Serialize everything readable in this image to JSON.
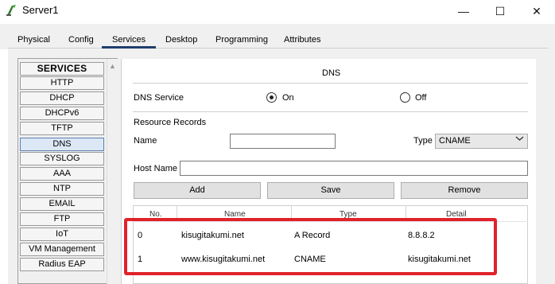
{
  "window": {
    "title": "Server1",
    "minimize_glyph": "—",
    "maximize_glyph": "☐",
    "close_glyph": "✕"
  },
  "tabs": [
    {
      "label": "Physical"
    },
    {
      "label": "Config"
    },
    {
      "label": "Services",
      "active": true
    },
    {
      "label": "Desktop"
    },
    {
      "label": "Programming"
    },
    {
      "label": "Attributes"
    }
  ],
  "services": {
    "header": "SERVICES",
    "items": [
      "HTTP",
      "DHCP",
      "DHCPv6",
      "TFTP",
      "DNS",
      "SYSLOG",
      "AAA",
      "NTP",
      "EMAIL",
      "FTP",
      "IoT",
      "VM Management",
      "Radius EAP"
    ],
    "selected": "DNS"
  },
  "dns": {
    "section_title": "DNS",
    "service_label": "DNS Service",
    "on_label": "On",
    "off_label": "Off",
    "service_state": "on",
    "records_label": "Resource Records",
    "name_label": "Name",
    "name_value": "",
    "type_label": "Type",
    "type_value": "CNAME",
    "host_label": "Host Name",
    "host_value": "",
    "buttons": {
      "add": "Add",
      "save": "Save",
      "remove": "Remove"
    },
    "table": {
      "columns": [
        "No.",
        "Name",
        "Type",
        "Detail"
      ],
      "rows": [
        {
          "no": "0",
          "name": "kisugitakumi.net",
          "type": "A Record",
          "detail": "8.8.8.2"
        },
        {
          "no": "1",
          "name": "www.kisugitakumi.net",
          "type": "CNAME",
          "detail": "kisugitakumi.net"
        }
      ]
    }
  },
  "colors": {
    "highlight": "#e0222a",
    "tab_underline": "#1f3d6b",
    "selected_item": "#dde8f7"
  }
}
